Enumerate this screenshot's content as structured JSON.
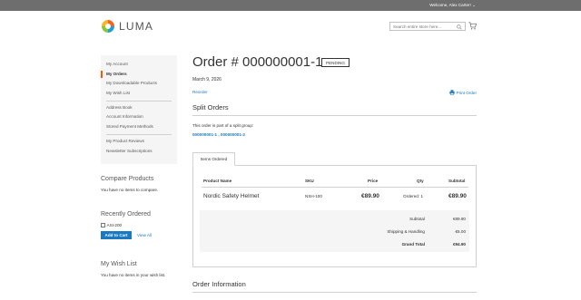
{
  "header": {
    "welcome": "Welcome, Alex Carter! ⌄",
    "logo_text": "LUMA",
    "search_placeholder": "Search entire store here...",
    "colors": {
      "topbar": "#6e6e6e",
      "accent": "#ff5501",
      "link": "#1979c3"
    }
  },
  "sidebar": {
    "nav_groups": [
      [
        "My Account",
        "My Orders",
        "My Downloadable Products",
        "My Wish List"
      ],
      [
        "Address Book",
        "Account Information",
        "Stored Payment Methods"
      ],
      [
        "My Product Reviews",
        "Newsletter Subscriptions"
      ]
    ],
    "active_item": "My Orders",
    "compare": {
      "title": "Compare Products",
      "text": "You have no items to compare."
    },
    "recent": {
      "title": "Recently Ordered",
      "item_label": "ASI-200",
      "add_to_cart": "Add to Cart",
      "view_all": "View All"
    },
    "wishlist": {
      "title": "My Wish List",
      "text": "You have no items in your wish list."
    }
  },
  "order": {
    "title": "Order # 000000001-1",
    "status": "PENDING",
    "date": "March 9, 2026",
    "reorder": "Reorder",
    "print": "Print Order",
    "split_title": "Split Orders",
    "split_text": "This order is part of a split group:",
    "split_links": "000000001-1 , 000000001-2",
    "tab_label": "Items Ordered",
    "columns": [
      "Product Name",
      "SKU",
      "Price",
      "Qty",
      "Subtotal"
    ],
    "item": {
      "name": "Nordic Safety Helmet",
      "sku": "NSH-100",
      "price": "€89.90",
      "qty": "Ordered: 1",
      "subtotal": "€89.90"
    },
    "totals": {
      "subtotal_label": "Subtotal",
      "subtotal": "€89.90",
      "shipping_label": "Shipping & Handling",
      "shipping": "€5.00",
      "grand_label": "Grand Total",
      "grand": "€94.90"
    },
    "info_title": "Order Information"
  }
}
